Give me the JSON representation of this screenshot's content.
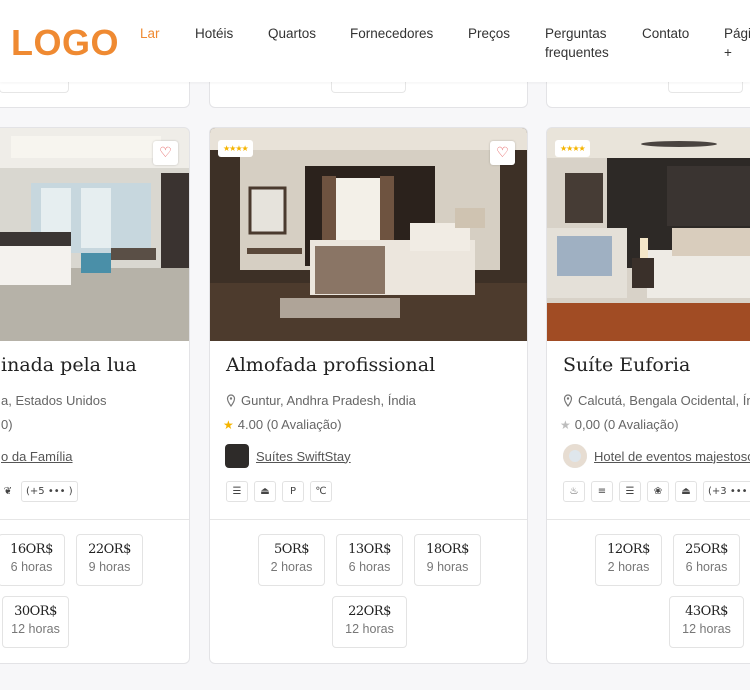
{
  "header": {
    "logo": "LOGO",
    "nav": [
      "Lar",
      "Hotéis",
      "Quartos",
      "Fornecedores",
      "Preços",
      "Perguntas",
      "frequentes",
      "Contato",
      "Pági",
      "+"
    ]
  },
  "cards": [
    {
      "title": "inada pela lua",
      "location": "a, Estados Unidos",
      "rating": "0)",
      "supplier": "o da Família",
      "amenities": [
        "bowl-icon",
        "(+5 ••• )"
      ],
      "prices": [
        {
          "amount": "16OR$",
          "hours": "6 horas"
        },
        {
          "amount": "22OR$",
          "hours": "9 horas"
        },
        {
          "amount": "30OR$",
          "hours": "12 horas"
        }
      ]
    },
    {
      "title": "Almofada profissional",
      "location": "Guntur, Andhra Pradesh, Índia",
      "rating": "4.00 (0 Avaliação)",
      "supplier": "Suítes SwiftStay",
      "stars": "★★★★",
      "amenities": [
        "☰",
        "⏏",
        "P",
        "℃"
      ],
      "prices": [
        {
          "amount": "5OR$",
          "hours": "2 horas"
        },
        {
          "amount": "13OR$",
          "hours": "6 horas"
        },
        {
          "amount": "18OR$",
          "hours": "9 horas"
        },
        {
          "amount": "22OR$",
          "hours": "12 horas"
        }
      ]
    },
    {
      "title": "Suíte Euforia",
      "location": "Calcutá, Bengala Ocidental, Ín",
      "rating": "0,00 (0 Avaliação)",
      "supplier": "Hotel de eventos majestoso",
      "stars": "★★★★",
      "amenities": [
        "♨",
        "≡",
        "☰",
        "❀",
        "⏏",
        "(+3 ••• )"
      ],
      "prices": [
        {
          "amount": "12OR$",
          "hours": "2 horas"
        },
        {
          "amount": "25OR$",
          "hours": "6 horas"
        },
        {
          "amount": "43OR$",
          "hours": "12 horas"
        }
      ]
    }
  ],
  "colors": {
    "accent": "#ef8a32",
    "heart": "#e24d4d",
    "star_gold": "#f5b400",
    "star_grey": "#bdbdbd"
  }
}
